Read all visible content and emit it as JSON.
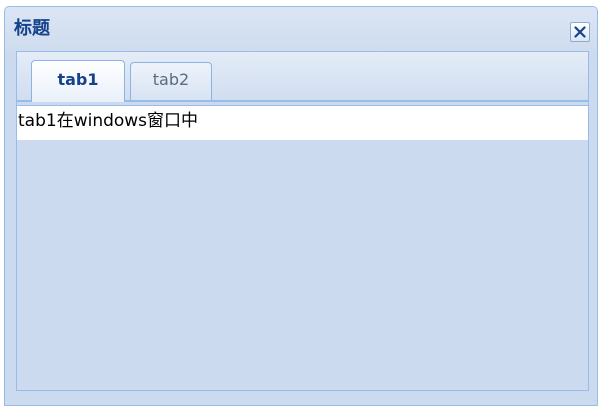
{
  "window": {
    "title": "标题",
    "close_icon": "close-icon"
  },
  "tabs": [
    {
      "label": "tab1",
      "active": true
    },
    {
      "label": "tab2",
      "active": false
    }
  ],
  "content": {
    "text": "tab1在windows窗口中"
  },
  "colors": {
    "title_text": "#15428b",
    "border": "#99bbe8",
    "panel_bg": "#cbdaee",
    "content_bg": "#ffffff"
  }
}
